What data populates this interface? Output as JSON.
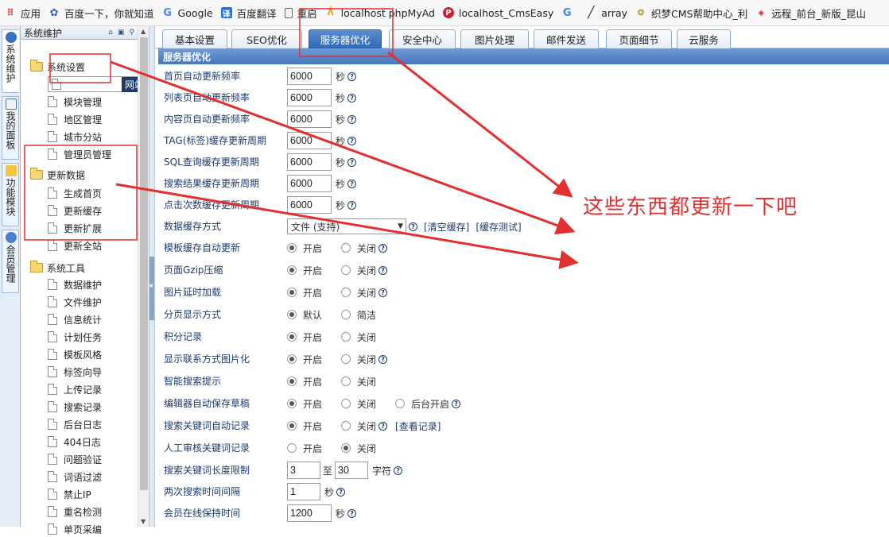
{
  "bookmarks": [
    {
      "label": "应用",
      "icon": "apps-grid-icon"
    },
    {
      "label": "百度一下，你就知道",
      "icon": "baidu-paw-icon"
    },
    {
      "label": "Google",
      "icon": "google-g-icon"
    },
    {
      "label": "百度翻译",
      "icon": "baidu-translate-icon"
    },
    {
      "label": "重启",
      "icon": "page-icon"
    },
    {
      "label": "localhost phpMyAd",
      "icon": "phpmyadmin-icon"
    },
    {
      "label": "localhost_CmsEasy",
      "icon": "cmseasy-p-icon"
    },
    {
      "label": "",
      "icon": "google-g-icon"
    },
    {
      "label": "array",
      "icon": "slash-icon"
    },
    {
      "label": "织梦CMS帮助中心_利",
      "icon": "dedecms-icon"
    },
    {
      "label": "远程_前台_新版_昆山",
      "icon": "remote-diamond-icon"
    }
  ],
  "vtabs": [
    {
      "label": "系统维护",
      "icon": "system-clock-icon",
      "active": true
    },
    {
      "label": "我的面板",
      "icon": "home-icon",
      "active": false
    },
    {
      "label": "功能模块",
      "icon": "module-gear-icon",
      "active": false
    },
    {
      "label": "会员管理",
      "icon": "member-user-icon",
      "active": false
    }
  ],
  "left_panel": {
    "title": "系统维护",
    "header_icons": [
      "home-icon",
      "restore-icon",
      "search-icon"
    ],
    "groups": [
      {
        "label": "系统设置",
        "items": [
          "网站设置",
          "模块管理",
          "地区管理",
          "城市分站",
          "管理员管理"
        ]
      },
      {
        "label": "更新数据",
        "items": [
          "生成首页",
          "更新缓存",
          "更新扩展",
          "更新全站"
        ]
      },
      {
        "label": "系统工具",
        "items": [
          "数据维护",
          "文件维护",
          "信息统计",
          "计划任务",
          "模板风格",
          "标签向导",
          "上传记录",
          "搜索记录",
          "后台日志",
          "404日志",
          "问题验证",
          "词语过滤",
          "禁止IP",
          "重名检测",
          "单页采编"
        ]
      }
    ],
    "selected": "网站设置"
  },
  "tabs": [
    "基本设置",
    "SEO优化",
    "服务器优化",
    "安全中心",
    "图片处理",
    "邮件发送",
    "页面细节",
    "云服务"
  ],
  "active_tab": "服务器优化",
  "section_title": "服务器优化",
  "labels": {
    "sec": "秒",
    "to": "至",
    "chars": "字符",
    "on": "开启",
    "off": "关闭",
    "default": "默认",
    "simple": "简洁",
    "backend_on": "后台开启",
    "help": "?"
  },
  "rows": {
    "home_freq": {
      "label": "首页自动更新频率",
      "value": "6000"
    },
    "list_freq": {
      "label": "列表页自动更新频率",
      "value": "6000"
    },
    "content_freq": {
      "label": "内容页自动更新频率",
      "value": "6000"
    },
    "tag_cycle": {
      "label": "TAG(标签)缓存更新周期",
      "value": "6000"
    },
    "sql_cycle": {
      "label": "SQL查询缓存更新周期",
      "value": "6000"
    },
    "search_cycle": {
      "label": "搜索结果缓存更新周期",
      "value": "6000"
    },
    "hits_cycle": {
      "label": "点击次数缓存更新周期",
      "value": "6000"
    },
    "cache_mode": {
      "label": "数据缓存方式",
      "value": "文件 (支持)",
      "link1": "[清空缓存]",
      "link2": "[缓存测试]"
    },
    "tpl_auto": {
      "label": "模板缓存自动更新",
      "selected": "on"
    },
    "gzip": {
      "label": "页面Gzip压缩",
      "selected": "on"
    },
    "img_lazy": {
      "label": "图片延时加载",
      "selected": "on"
    },
    "paging": {
      "label": "分页显示方式",
      "selected": "default"
    },
    "points": {
      "label": "积分记录",
      "selected": "on"
    },
    "contact_img": {
      "label": "显示联系方式图片化",
      "selected": "on"
    },
    "smart_search": {
      "label": "智能搜索提示",
      "selected": "on"
    },
    "editor_save": {
      "label": "编辑器自动保存草稿",
      "selected": "on"
    },
    "kw_record": {
      "label": "搜索关键词自动记录",
      "selected": "on",
      "link": "[查看记录]"
    },
    "kw_review": {
      "label": "人工审核关键词记录",
      "selected": "off"
    },
    "kw_len": {
      "label": "搜索关键词长度限制",
      "min": "3",
      "max": "30"
    },
    "search_interval": {
      "label": "两次搜索时间间隔",
      "value": "1"
    },
    "online_keep": {
      "label": "会员在线保持时间",
      "value": "1200"
    }
  },
  "annotation": {
    "text": "这些东西都更新一下吧",
    "color": "#e03030"
  }
}
